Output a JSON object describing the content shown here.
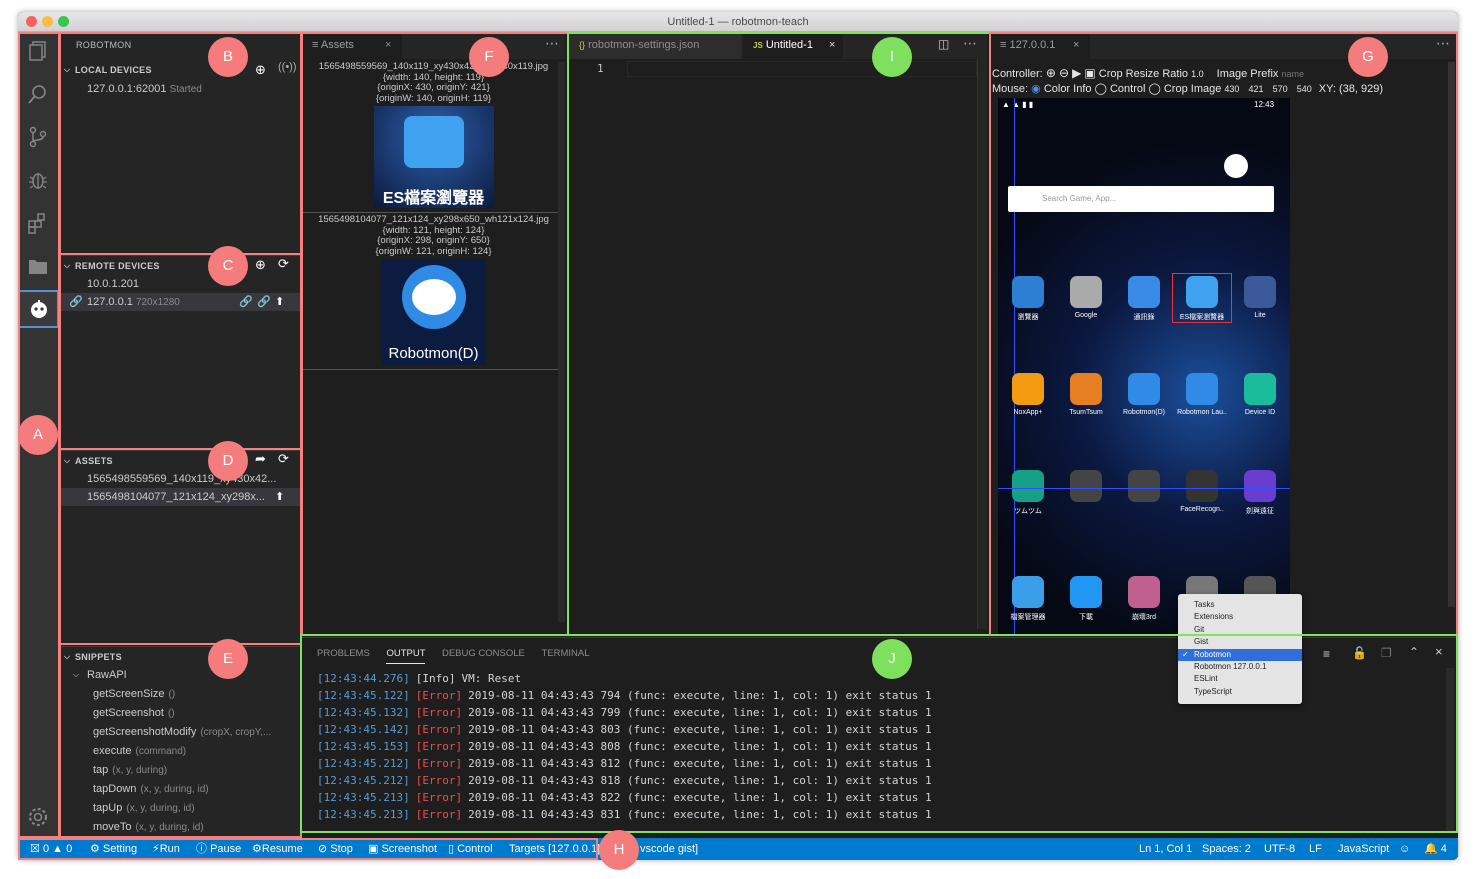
{
  "window": {
    "title": "Untitled-1 — robotmon-teach"
  },
  "sidebar": {
    "title": "ROBOTMON",
    "local": {
      "header": "LOCAL DEVICES",
      "items": [
        {
          "name": "127.0.0.1:62001",
          "status": "Started"
        }
      ]
    },
    "remote": {
      "header": "REMOTE DEVICES",
      "items": [
        {
          "name": "10.0.1.201",
          "res": ""
        },
        {
          "name": "127.0.0.1",
          "res": "720x1280"
        }
      ]
    },
    "assets": {
      "header": "ASSETS",
      "items": [
        "1565498559569_140x119_xy430x42...",
        "1565498104077_121x124_xy298x..."
      ]
    },
    "snippets": {
      "header": "SNIPPETS",
      "group": "RawAPI",
      "items": [
        {
          "name": "getScreenSize",
          "args": "()"
        },
        {
          "name": "getScreenshot",
          "args": "()"
        },
        {
          "name": "getScreenshotModify",
          "args": "(cropX, cropY,..."
        },
        {
          "name": "execute",
          "args": "(command)"
        },
        {
          "name": "tap",
          "args": "(x, y, during)"
        },
        {
          "name": "tapDown",
          "args": "(x, y, during, id)"
        },
        {
          "name": "tapUp",
          "args": "(x, y, during, id)"
        },
        {
          "name": "moveTo",
          "args": "(x, y, during, id)"
        }
      ]
    }
  },
  "assets_panel": {
    "tab": "Assets",
    "entries": [
      {
        "file": "1565498559569_140x119_xy430x421_wh140x119.jpg",
        "size": "{width: 140, height: 119}",
        "origin": "{originX: 430, originY: 421}",
        "originwh": "{originW: 140, originH: 119}",
        "caption": "ES檔案瀏覽器"
      },
      {
        "file": "1565498104077_121x124_xy298x650_wh121x124.jpg",
        "size": "{width: 121, height: 124}",
        "origin": "{originX: 298, originY: 650}",
        "originwh": "{originW: 121, originH: 124}",
        "caption": "Robotmon(D)"
      }
    ]
  },
  "editor": {
    "tabs": [
      {
        "label": "robotmon-settings.json",
        "icon": "{}"
      },
      {
        "label": "Untitled-1",
        "icon": "JS"
      }
    ],
    "line_number": "1"
  },
  "device": {
    "tab": "127.0.0.1",
    "controller_label": "Controller:",
    "crop_resize": "Crop Resize Ratio",
    "crop_ratio": "1.0",
    "image_prefix": "Image Prefix",
    "prefix_placeholder": "name",
    "mouse_label": "Mouse:",
    "opt_color": "Color Info",
    "opt_control": "Control",
    "opt_crop": "Crop Image",
    "crop_vals": [
      "430",
      "421",
      "570",
      "540"
    ],
    "xy": "XY: (38, 929)",
    "phone": {
      "time": "12:43",
      "search": "Search Game, App...",
      "apps_row1": [
        "瀏覽器",
        "Google",
        "通訊錄",
        "ES檔案瀏覽器",
        "Lite"
      ],
      "apps_row2": [
        "NoxApp+",
        "TsumTsum",
        "Robotmon(D)",
        "Robotmon Lau..",
        "Device ID"
      ],
      "apps_row3": [
        "ツムツム",
        "",
        "",
        "FaceRecogn..",
        "劍與遠征"
      ],
      "dock": [
        "檔案管理器",
        "下載",
        "崩壞3rd",
        "",
        ""
      ]
    }
  },
  "panel": {
    "tabs": [
      "PROBLEMS",
      "OUTPUT",
      "DEBUG CONSOLE",
      "TERMINAL"
    ],
    "dropdown": [
      "Tasks",
      "Extensions",
      "Git",
      "Gist",
      "Robotmon",
      "Robotmon 127.0.0.1",
      "ESLint",
      "TypeScript"
    ],
    "dropdown_selected": "Robotmon",
    "lines": [
      {
        "ts": "[12:43:44.276]",
        "lvl": "[Info]",
        "msg": "VM: Reset"
      },
      {
        "ts": "[12:43:45.122]",
        "lvl": "[Error]",
        "msg": "2019-08-11 04:43:43 794 (func: execute, line: 1, col: 1) exit status 1"
      },
      {
        "ts": "[12:43:45.132]",
        "lvl": "[Error]",
        "msg": "2019-08-11 04:43:43 799 (func: execute, line: 1, col: 1) exit status 1"
      },
      {
        "ts": "[12:43:45.142]",
        "lvl": "[Error]",
        "msg": "2019-08-11 04:43:43 803 (func: execute, line: 1, col: 1) exit status 1"
      },
      {
        "ts": "[12:43:45.153]",
        "lvl": "[Error]",
        "msg": "2019-08-11 04:43:43 808 (func: execute, line: 1, col: 1) exit status 1"
      },
      {
        "ts": "[12:43:45.212]",
        "lvl": "[Error]",
        "msg": "2019-08-11 04:43:43 812 (func: execute, line: 1, col: 1) exit status 1"
      },
      {
        "ts": "[12:43:45.212]",
        "lvl": "[Error]",
        "msg": "2019-08-11 04:43:43 818 (func: execute, line: 1, col: 1) exit status 1"
      },
      {
        "ts": "[12:43:45.213]",
        "lvl": "[Error]",
        "msg": "2019-08-11 04:43:43 822 (func: execute, line: 1, col: 1) exit status 1"
      },
      {
        "ts": "[12:43:45.213]",
        "lvl": "[Error]",
        "msg": "2019-08-11 04:43:43 831 (func: execute, line: 1, col: 1) exit status 1"
      }
    ]
  },
  "status": {
    "errors": "0",
    "warnings": "0",
    "items": [
      "Setting",
      "Run",
      "Pause",
      "Resume",
      "Stop",
      "Screenshot",
      "Control",
      "Targets [127.0.0.1]",
      "vscode gist]"
    ],
    "right": [
      "Ln 1, Col 1",
      "Spaces: 2",
      "UTF-8",
      "LF",
      "JavaScript"
    ],
    "bell": "4"
  },
  "labels": [
    "A",
    "B",
    "C",
    "D",
    "E",
    "F",
    "G",
    "H",
    "I",
    "J"
  ],
  "colors": {
    "red_box": "#f48080",
    "green_box": "#7fe35f",
    "status_bg": "#007acc",
    "error": "#f14c4c",
    "timestamp": "#569cd6"
  }
}
